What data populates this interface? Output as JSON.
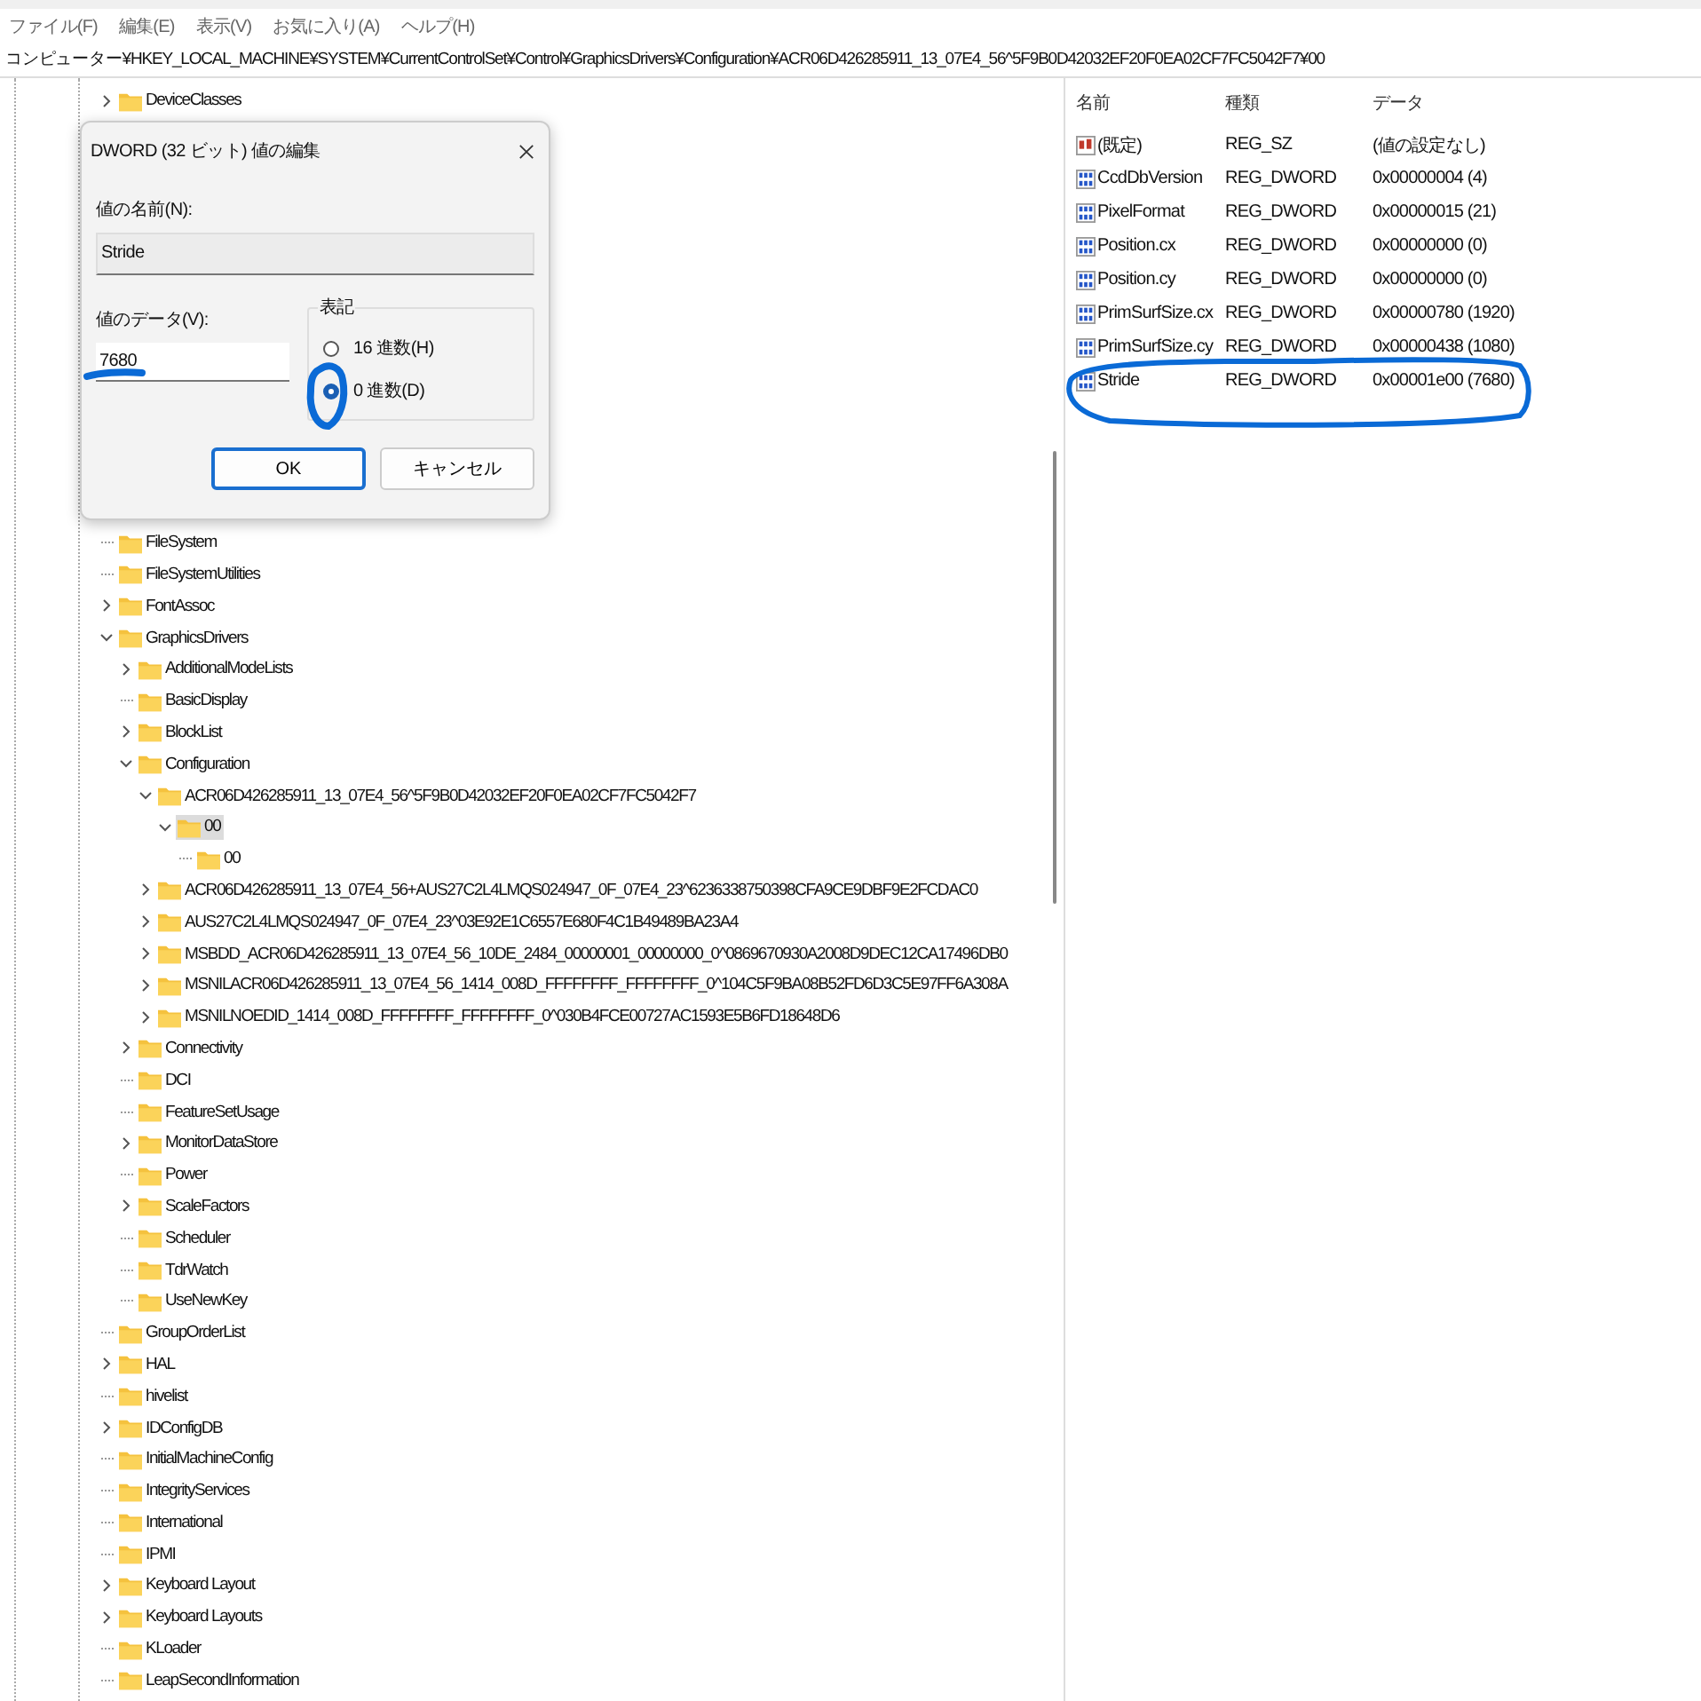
{
  "menu": [
    "ファイル(F)",
    "編集(E)",
    "表示(V)",
    "お気に入り(A)",
    "ヘルプ(H)"
  ],
  "address": "コンピューター¥HKEY_LOCAL_MACHINE¥SYSTEM¥CurrentControlSet¥Control¥GraphicsDrivers¥Configuration¥ACR06D426285911_13_07E4_56^5F9B0D42032EF20F0EA02CF7FC5042F7¥00",
  "tree_top": [
    {
      "label": "DeviceClasses",
      "kind": "collapsed",
      "selected": false
    }
  ],
  "tree": [
    {
      "label": "FileSystem",
      "kind": "leaf",
      "selected": false
    },
    {
      "label": "FileSystemUtilities",
      "kind": "leaf",
      "selected": false
    },
    {
      "label": "FontAssoc",
      "kind": "collapsed",
      "selected": false
    },
    {
      "label": "GraphicsDrivers",
      "kind": "expanded",
      "selected": false,
      "children": [
        {
          "label": "AdditionalModeLists",
          "kind": "collapsed",
          "selected": false
        },
        {
          "label": "BasicDisplay",
          "kind": "leaf",
          "selected": false
        },
        {
          "label": "BlockList",
          "kind": "collapsed",
          "selected": false
        },
        {
          "label": "Configuration",
          "kind": "expanded",
          "selected": false,
          "children": [
            {
              "label": "ACR06D426285911_13_07E4_56^5F9B0D42032EF20F0EA02CF7FC5042F7",
              "kind": "expanded",
              "selected": false,
              "children": [
                {
                  "label": "00",
                  "kind": "expanded",
                  "selected": true,
                  "children": [
                    {
                      "label": "00",
                      "kind": "leaf",
                      "selected": false
                    }
                  ]
                }
              ]
            },
            {
              "label": "ACR06D426285911_13_07E4_56+AUS27C2L4LMQS024947_0F_07E4_23^6236338750398CFA9CE9DBF9E2FCDAC0",
              "kind": "collapsed",
              "selected": false
            },
            {
              "label": "AUS27C2L4LMQS024947_0F_07E4_23^03E92E1C6557E680F4C1B49489BA23A4",
              "kind": "collapsed",
              "selected": false
            },
            {
              "label": "MSBDD_ACR06D426285911_13_07E4_56_10DE_2484_00000001_00000000_0^0869670930A2008D9DEC12CA17496DB0",
              "kind": "collapsed",
              "selected": false
            },
            {
              "label": "MSNILACR06D426285911_13_07E4_56_1414_008D_FFFFFFFF_FFFFFFFF_0^104C5F9BA08B52FD6D3C5E97FF6A308A",
              "kind": "collapsed",
              "selected": false
            },
            {
              "label": "MSNILNOEDID_1414_008D_FFFFFFFF_FFFFFFFF_0^030B4FCE00727AC1593E5B6FD18648D6",
              "kind": "collapsed",
              "selected": false
            }
          ]
        },
        {
          "label": "Connectivity",
          "kind": "collapsed",
          "selected": false
        },
        {
          "label": "DCI",
          "kind": "leaf",
          "selected": false
        },
        {
          "label": "FeatureSetUsage",
          "kind": "leaf",
          "selected": false
        },
        {
          "label": "MonitorDataStore",
          "kind": "collapsed",
          "selected": false
        },
        {
          "label": "Power",
          "kind": "leaf",
          "selected": false
        },
        {
          "label": "ScaleFactors",
          "kind": "collapsed",
          "selected": false
        },
        {
          "label": "Scheduler",
          "kind": "leaf",
          "selected": false
        },
        {
          "label": "TdrWatch",
          "kind": "leaf",
          "selected": false
        },
        {
          "label": "UseNewKey",
          "kind": "leaf",
          "selected": false
        }
      ]
    },
    {
      "label": "GroupOrderList",
      "kind": "leaf",
      "selected": false
    },
    {
      "label": "HAL",
      "kind": "collapsed",
      "selected": false
    },
    {
      "label": "hivelist",
      "kind": "leaf",
      "selected": false
    },
    {
      "label": "IDConfigDB",
      "kind": "collapsed",
      "selected": false
    },
    {
      "label": "InitialMachineConfig",
      "kind": "leaf",
      "selected": false
    },
    {
      "label": "IntegrityServices",
      "kind": "leaf",
      "selected": false
    },
    {
      "label": "International",
      "kind": "leaf",
      "selected": false
    },
    {
      "label": "IPMI",
      "kind": "leaf",
      "selected": false
    },
    {
      "label": "Keyboard Layout",
      "kind": "collapsed",
      "selected": false
    },
    {
      "label": "Keyboard Layouts",
      "kind": "collapsed",
      "selected": false
    },
    {
      "label": "KLoader",
      "kind": "leaf",
      "selected": false
    },
    {
      "label": "LeapSecondInformation",
      "kind": "leaf",
      "selected": false
    }
  ],
  "values": {
    "columns": [
      "名前",
      "種類",
      "データ"
    ],
    "rows": [
      {
        "kind": "string",
        "name": "(既定)",
        "type": "REG_SZ",
        "data": "(値の設定なし)"
      },
      {
        "kind": "dword",
        "name": "CcdDbVersion",
        "type": "REG_DWORD",
        "data": "0x00000004 (4)"
      },
      {
        "kind": "dword",
        "name": "PixelFormat",
        "type": "REG_DWORD",
        "data": "0x00000015 (21)"
      },
      {
        "kind": "dword",
        "name": "Position.cx",
        "type": "REG_DWORD",
        "data": "0x00000000 (0)"
      },
      {
        "kind": "dword",
        "name": "Position.cy",
        "type": "REG_DWORD",
        "data": "0x00000000 (0)"
      },
      {
        "kind": "dword",
        "name": "PrimSurfSize.cx",
        "type": "REG_DWORD",
        "data": "0x00000780 (1920)"
      },
      {
        "kind": "dword",
        "name": "PrimSurfSize.cy",
        "type": "REG_DWORD",
        "data": "0x00000438 (1080)"
      },
      {
        "kind": "dword",
        "name": "Stride",
        "type": "REG_DWORD",
        "data": "0x00001e00 (7680)"
      }
    ]
  },
  "dialog": {
    "title": "DWORD (32 ビット) 値の編集",
    "name_label": "値の名前(N):",
    "name_value": "Stride",
    "data_label": "値のデータ(V):",
    "data_value": "7680",
    "base_label": "表記",
    "bases": [
      {
        "label": "16 進数(H)",
        "selected": false
      },
      {
        "label": "0 進数(D)",
        "selected": true
      }
    ],
    "buttons": [
      {
        "label": "OK",
        "default": true
      },
      {
        "label": "キャンセル",
        "default": false
      }
    ]
  }
}
